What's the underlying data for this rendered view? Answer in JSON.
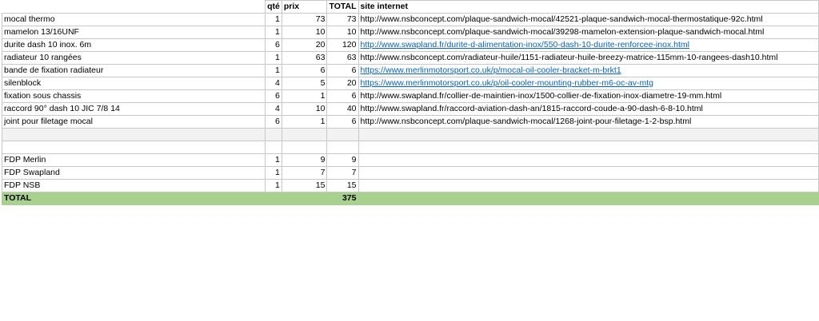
{
  "headers": {
    "qte": "qté",
    "prix": "prix",
    "total": "TOTAL",
    "site": "site internet"
  },
  "rows": [
    {
      "name": "mocal thermo",
      "qte": "1",
      "prix": "73",
      "total": "73",
      "site": "http://www.nsbconcept.com/plaque-sandwich-mocal/42521-plaque-sandwich-mocal-thermostatique-92c.html",
      "link": false
    },
    {
      "name": "mamelon 13/16UNF",
      "qte": "1",
      "prix": "10",
      "total": "10",
      "site": "http://www.nsbconcept.com/plaque-sandwich-mocal/39298-mamelon-extension-plaque-sandwich-mocal.html",
      "link": false
    },
    {
      "name": "durite dash 10 inox. 6m",
      "qte": "6",
      "prix": "20",
      "total": "120",
      "site": "http://www.swapland.fr/durite-d-alimentation-inox/550-dash-10-durite-renforcee-inox.html",
      "link": true
    },
    {
      "name": "radiateur 10 rangées",
      "qte": "1",
      "prix": "63",
      "total": "63",
      "site": "http://www.nsbconcept.com/radiateur-huile/1151-radiateur-huile-breezy-matrice-115mm-10-rangees-dash10.html",
      "link": false
    },
    {
      "name": "bande de fixation radiateur",
      "qte": "1",
      "prix": "6",
      "total": "6",
      "site": "https://www.merlinmotorsport.co.uk/p/mocal-oil-cooler-bracket-m-brkt1",
      "link": true
    },
    {
      "name": "silenblock",
      "qte": "4",
      "prix": "5",
      "total": "20",
      "site": "https://www.merlinmotorsport.co.uk/p/oil-cooler-mounting-rubber-m6-oc-av-mtg",
      "link": true
    },
    {
      "name": "fixation sous chassis",
      "qte": "6",
      "prix": "1",
      "total": "6",
      "site": "http://www.swapland.fr/collier-de-maintien-inox/1500-collier-de-fixation-inox-diametre-19-mm.html",
      "link": false
    },
    {
      "name": "raccord 90° dash 10 JIC 7/8 14",
      "qte": "4",
      "prix": "10",
      "total": "40",
      "site": "http://www.swapland.fr/raccord-aviation-dash-an/1815-raccord-coude-a-90-dash-6-8-10.html",
      "link": false
    },
    {
      "name": "joint pour filetage mocal",
      "qte": "6",
      "prix": "1",
      "total": "6",
      "site": "http://www.nsbconcept.com/plaque-sandwich-mocal/1268-joint-pour-filetage-1-2-bsp.html",
      "link": false
    }
  ],
  "fdp": [
    {
      "name": "FDP Merlin",
      "qte": "1",
      "prix": "9",
      "total": "9"
    },
    {
      "name": "FDP Swapland",
      "qte": "1",
      "prix": "7",
      "total": "7"
    },
    {
      "name": "FDP NSB",
      "qte": "1",
      "prix": "15",
      "total": "15"
    }
  ],
  "grand_total": {
    "label": "TOTAL",
    "value": "375"
  },
  "colors": {
    "total_row": "#a9d18e",
    "link": "#0563c1",
    "separator_row": "#f2f2f2"
  }
}
